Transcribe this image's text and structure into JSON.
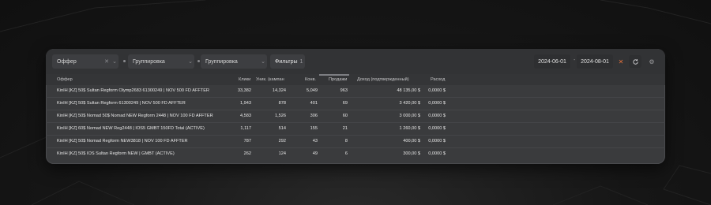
{
  "toolbar": {
    "offer_select": {
      "label": "Оффер",
      "clear_icon": "close-icon",
      "arrow_icon": "chevron-down-icon"
    },
    "group_select_1": {
      "label": "Группировка",
      "arrow_icon": "chevron-down-icon"
    },
    "group_select_2": {
      "label": "Группировка",
      "arrow_icon": "chevron-down-icon"
    },
    "filters": {
      "label": "Фильтры",
      "count": "1"
    },
    "date_from": "2024-06-01",
    "date_sep": "-",
    "date_to": "2024-08-01",
    "clear_dates_icon": "close-icon",
    "refresh_icon": "refresh-icon",
    "settings_icon": "gear-icon",
    "accent_color": "#e0703c"
  },
  "table": {
    "headers": {
      "offer": "Оффер",
      "clicks": "Клики",
      "unique": "Уник. (кампан",
      "conv": "Конв.",
      "sales": "Продажи",
      "income": "Доход (подтвержденный)",
      "expense": "Расход"
    },
    "rows": [
      {
        "offer": "KinIH [KZ] 50$ Sultan Regform Olymp2683 61300249 | NOV 500 FD AFFTER",
        "clicks": "33,382",
        "unique": "14,324",
        "conv": "5,049",
        "sales": "963",
        "income": "48 135,00 $",
        "expense": "0,0000 $"
      },
      {
        "offer": "KinIH [KZ] 50$ Sultan Regform 61300249 | NOV 500 FD AFFTER",
        "clicks": "1,943",
        "unique": "878",
        "conv": "401",
        "sales": "69",
        "income": "3 420,00 $",
        "expense": "0,0000 $"
      },
      {
        "offer": "KinIH [KZ] 50$ Nomad 50$ Nomad NEW Regform 2448 | NOV 100 FD AFFTER",
        "clicks": "4,583",
        "unique": "1,526",
        "conv": "306",
        "sales": "60",
        "income": "3 000,00 $",
        "expense": "0,0000 $"
      },
      {
        "offer": "KinIH [KZ] 60$ Nomad NEW Reg2448 | IOS5 GMBT 150FD Total (ACTIVE)",
        "clicks": "1,117",
        "unique": "514",
        "conv": "155",
        "sales": "21",
        "income": "1 260,00 $",
        "expense": "0,0000 $"
      },
      {
        "offer": "KinIH [KZ] 50$ Nomad Regform NEW3818 | NOV 100 FD AFFTER",
        "clicks": "787",
        "unique": "292",
        "conv": "43",
        "sales": "8",
        "income": "400,00 $",
        "expense": "0,0000 $"
      },
      {
        "offer": "KinIH [KZ] 50$ IOS Sultan Regform NEW | GMBT (ACTIVE)",
        "clicks": "262",
        "unique": "124",
        "conv": "49",
        "sales": "6",
        "income": "300,00 $",
        "expense": "0,0000 $"
      }
    ]
  }
}
